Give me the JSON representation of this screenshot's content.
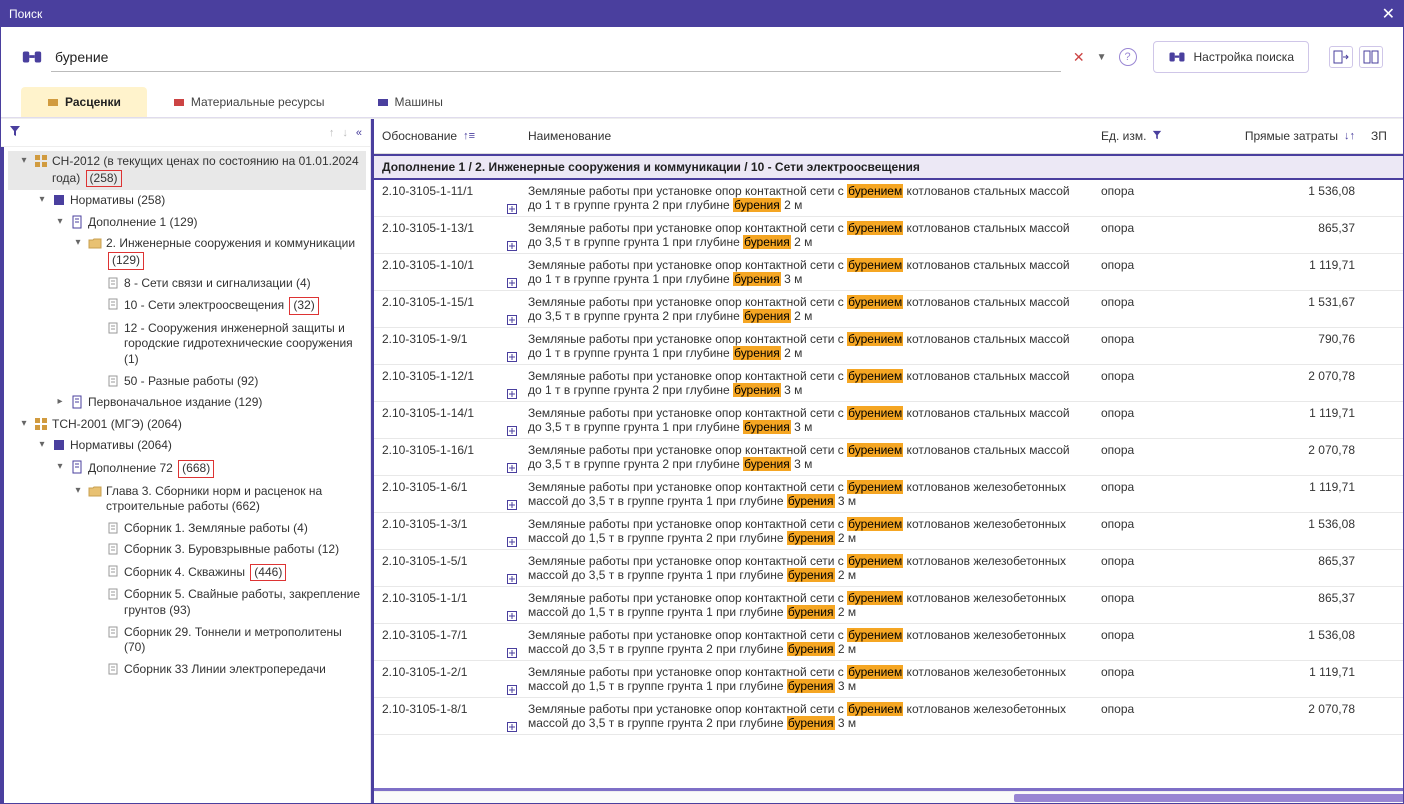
{
  "window": {
    "title": "Поиск",
    "close": "✕"
  },
  "search": {
    "value": "бурение",
    "clear": "✕",
    "settings": "Настройка поиска",
    "help": "?"
  },
  "tabs": [
    {
      "label": "Расценки",
      "active": true
    },
    {
      "label": "Материальные ресурсы",
      "active": false
    },
    {
      "label": "Машины",
      "active": false
    }
  ],
  "tree": [
    {
      "indent": 0,
      "chev": "▾",
      "icon": "db",
      "label": "СН-2012 (в текущих ценах по состоянию на 01.01.2024 года)",
      "count": "(258)",
      "counthi": true,
      "sel": true
    },
    {
      "indent": 1,
      "chev": "▾",
      "icon": "book",
      "label": "Нормативы",
      "count": "(258)",
      "counthi": false
    },
    {
      "indent": 2,
      "chev": "▾",
      "icon": "doc",
      "label": "Дополнение 1",
      "count": "(129)",
      "counthi": false
    },
    {
      "indent": 3,
      "chev": "▾",
      "icon": "folder",
      "label": "2. Инженерные сооружения и коммуникации",
      "count": "(129)",
      "counthi": true
    },
    {
      "indent": 4,
      "chev": "",
      "icon": "page",
      "label": "8 - Сети связи и сигнализации",
      "count": "(4)",
      "counthi": false
    },
    {
      "indent": 4,
      "chev": "",
      "icon": "page",
      "label": "10 - Сети электроосвещения",
      "count": "(32)",
      "counthi": true
    },
    {
      "indent": 4,
      "chev": "",
      "icon": "page",
      "label": "12 - Сооружения инженерной защиты и городские гидротехнические сооружения",
      "count": "(1)",
      "counthi": false
    },
    {
      "indent": 4,
      "chev": "",
      "icon": "page",
      "label": "50 - Разные работы",
      "count": "(92)",
      "counthi": false
    },
    {
      "indent": 2,
      "chev": "▸",
      "icon": "doc",
      "label": "Первоначальное издание",
      "count": "(129)",
      "counthi": false
    },
    {
      "indent": 0,
      "chev": "▾",
      "icon": "db",
      "label": "ТСН-2001 (МГЭ)",
      "count": "(2064)",
      "counthi": false
    },
    {
      "indent": 1,
      "chev": "▾",
      "icon": "book",
      "label": "Нормативы",
      "count": "(2064)",
      "counthi": false
    },
    {
      "indent": 2,
      "chev": "▾",
      "icon": "doc",
      "label": "Дополнение 72",
      "count": "(668)",
      "counthi": true
    },
    {
      "indent": 3,
      "chev": "▾",
      "icon": "folder",
      "label": "Глава  3. Сборники норм и расценок на строительные работы",
      "count": "(662)",
      "counthi": false
    },
    {
      "indent": 4,
      "chev": "",
      "icon": "page",
      "label": "Сборник  1. Земляные работы",
      "count": "(4)",
      "counthi": false
    },
    {
      "indent": 4,
      "chev": "",
      "icon": "page",
      "label": "Сборник  3. Буровзрывные работы",
      "count": "(12)",
      "counthi": false
    },
    {
      "indent": 4,
      "chev": "",
      "icon": "page",
      "label": "Сборник  4. Скважины",
      "count": "(446)",
      "counthi": true
    },
    {
      "indent": 4,
      "chev": "",
      "icon": "page",
      "label": "Сборник  5. Свайные работы, закрепление грунтов",
      "count": "(93)",
      "counthi": false
    },
    {
      "indent": 4,
      "chev": "",
      "icon": "page",
      "label": "Сборник 29. Тоннели и метрополитены",
      "count": "(70)",
      "counthi": false
    },
    {
      "indent": 4,
      "chev": "",
      "icon": "page",
      "label": "Сборник 33  Линии электропередачи",
      "count": "",
      "counthi": false
    }
  ],
  "grid": {
    "columns": {
      "just": "Обоснование",
      "name": "Наименование",
      "unit": "Ед. изм.",
      "cost": "Прямые затраты",
      "zp": "ЗП"
    },
    "group": "Дополнение 1 / 2. Инженерные сооружения и коммуникации / 10 - Сети электроосвещения",
    "rows": [
      {
        "just": "2.10-3105-1-11/1",
        "name_pre": "Земляные работы при установке опор контактной сети с ",
        "m1": "бурением",
        "name_mid": " котлованов стальных массой до 1 т в группе грунта 2 при глубине ",
        "m2": "бурения",
        "name_post": " 2 м",
        "unit": "опора",
        "cost": "1 536,08"
      },
      {
        "just": "2.10-3105-1-13/1",
        "name_pre": "Земляные работы при установке опор контактной сети с ",
        "m1": "бурением",
        "name_mid": " котлованов стальных массой до 3,5 т в группе грунта 1 при глубине ",
        "m2": "бурения",
        "name_post": " 2 м",
        "unit": "опора",
        "cost": "865,37"
      },
      {
        "just": "2.10-3105-1-10/1",
        "name_pre": "Земляные работы при установке опор контактной сети с ",
        "m1": "бурением",
        "name_mid": " котлованов стальных массой до 1 т в группе грунта 1 при глубине ",
        "m2": "бурения",
        "name_post": " 3 м",
        "unit": "опора",
        "cost": "1 119,71"
      },
      {
        "just": "2.10-3105-1-15/1",
        "name_pre": "Земляные работы при установке опор контактной сети с ",
        "m1": "бурением",
        "name_mid": " котлованов стальных массой до 3,5 т в группе грунта 2 при глубине ",
        "m2": "бурения",
        "name_post": " 2 м",
        "unit": "опора",
        "cost": "1 531,67"
      },
      {
        "just": "2.10-3105-1-9/1",
        "name_pre": "Земляные работы при установке опор контактной сети с ",
        "m1": "бурением",
        "name_mid": " котлованов стальных массой до 1 т в группе грунта 1 при глубине ",
        "m2": "бурения",
        "name_post": " 2 м",
        "unit": "опора",
        "cost": "790,76"
      },
      {
        "just": "2.10-3105-1-12/1",
        "name_pre": "Земляные работы при установке опор контактной сети с ",
        "m1": "бурением",
        "name_mid": " котлованов стальных массой до 1 т в группе грунта 2 при глубине ",
        "m2": "бурения",
        "name_post": " 3 м",
        "unit": "опора",
        "cost": "2 070,78"
      },
      {
        "just": "2.10-3105-1-14/1",
        "name_pre": "Земляные работы при установке опор контактной сети с ",
        "m1": "бурением",
        "name_mid": " котлованов стальных массой до 3,5 т в группе грунта 1 при глубине ",
        "m2": "бурения",
        "name_post": " 3 м",
        "unit": "опора",
        "cost": "1 119,71"
      },
      {
        "just": "2.10-3105-1-16/1",
        "name_pre": "Земляные работы при установке опор контактной сети с ",
        "m1": "бурением",
        "name_mid": " котлованов стальных массой до 3,5 т в группе грунта 2 при глубине ",
        "m2": "бурения",
        "name_post": " 3 м",
        "unit": "опора",
        "cost": "2 070,78"
      },
      {
        "just": "2.10-3105-1-6/1",
        "name_pre": "Земляные работы при установке опор контактной сети с ",
        "m1": "бурением",
        "name_mid": " котлованов железобетонных массой до 3,5 т в группе грунта 1 при глубине ",
        "m2": "бурения",
        "name_post": " 3 м",
        "unit": "опора",
        "cost": "1 119,71"
      },
      {
        "just": "2.10-3105-1-3/1",
        "name_pre": "Земляные работы при установке опор контактной сети с ",
        "m1": "бурением",
        "name_mid": " котлованов железобетонных массой до 1,5 т в группе грунта 2 при глубине ",
        "m2": "бурения",
        "name_post": " 2 м",
        "unit": "опора",
        "cost": "1 536,08"
      },
      {
        "just": "2.10-3105-1-5/1",
        "name_pre": "Земляные работы при установке опор контактной сети с ",
        "m1": "бурением",
        "name_mid": " котлованов железобетонных массой до 3,5 т в группе грунта 1 при глубине ",
        "m2": "бурения",
        "name_post": " 2 м",
        "unit": "опора",
        "cost": "865,37"
      },
      {
        "just": "2.10-3105-1-1/1",
        "name_pre": "Земляные работы при установке опор контактной сети с ",
        "m1": "бурением",
        "name_mid": " котлованов железобетонных массой до 1,5 т в группе грунта 1 при глубине ",
        "m2": "бурения",
        "name_post": " 2 м",
        "unit": "опора",
        "cost": "865,37"
      },
      {
        "just": "2.10-3105-1-7/1",
        "name_pre": "Земляные работы при установке опор контактной сети с ",
        "m1": "бурением",
        "name_mid": " котлованов железобетонных массой до 3,5 т в группе грунта 2 при глубине ",
        "m2": "бурения",
        "name_post": " 2 м",
        "unit": "опора",
        "cost": "1 536,08"
      },
      {
        "just": "2.10-3105-1-2/1",
        "name_pre": "Земляные работы при установке опор контактной сети с ",
        "m1": "бурением",
        "name_mid": " котлованов железобетонных массой до 1,5 т в группе грунта 1 при глубине ",
        "m2": "бурения",
        "name_post": " 3 м",
        "unit": "опора",
        "cost": "1 119,71"
      },
      {
        "just": "2.10-3105-1-8/1",
        "name_pre": "Земляные работы при установке опор контактной сети с ",
        "m1": "бурением",
        "name_mid": " котлованов железобетонных массой до 3,5 т в группе грунта 2 при глубине ",
        "m2": "бурения",
        "name_post": " 3 м",
        "unit": "опора",
        "cost": "2 070,78"
      }
    ],
    "widths": {
      "just": 130,
      "unit": 130,
      "cost": 140,
      "zp": 40
    }
  }
}
